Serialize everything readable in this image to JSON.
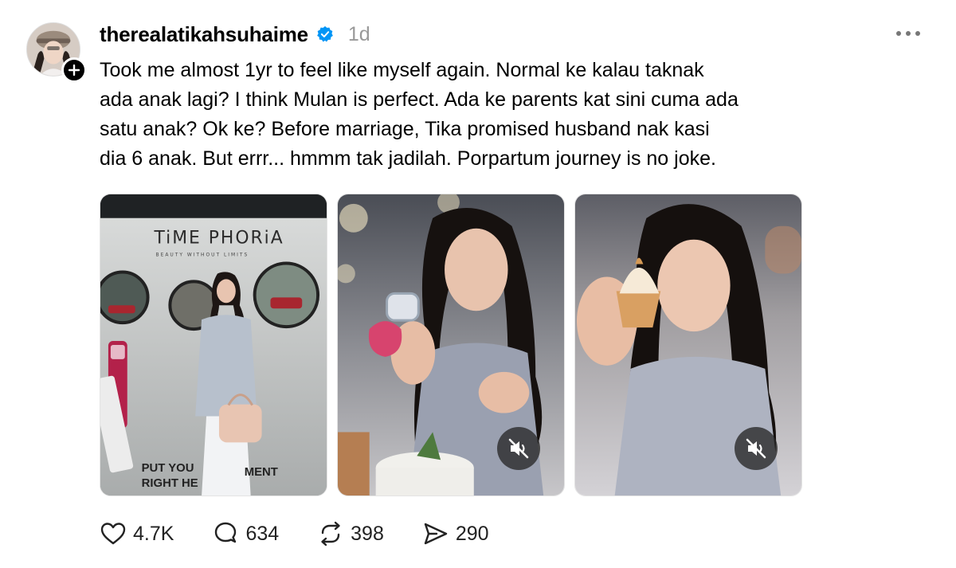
{
  "post": {
    "username": "therealatikahsuhaime",
    "verified": true,
    "timestamp": "1d",
    "caption_lines": [
      "Took me almost 1yr to feel like myself again. Normal ke kalau taknak",
      "ada anak lagi? I think Mulan is perfect. Ada ke parents kat sini cuma ada",
      "satu anak? Ok ke? Before marriage, Tika promised husband nak kasi",
      "dia 6 anak. But errr... hmmm tak jadilah. Porpartum journey is no joke."
    ],
    "media": [
      {
        "type": "image",
        "sign_brand": "TiME PHORiA",
        "sign_tagline": "BEAUTY WITHOUT LIMITS",
        "sign_bottom_line1": "PUT YOU",
        "sign_bottom_line1b": "MENT",
        "sign_bottom_line2": "RIGHT HE"
      },
      {
        "type": "video",
        "muted": true,
        "mute_icon": "speaker-muted-icon"
      },
      {
        "type": "video",
        "muted": true,
        "mute_icon": "speaker-muted-icon"
      }
    ],
    "stats": {
      "likes": "4.7K",
      "comments": "634",
      "reposts": "398",
      "shares": "290"
    }
  },
  "colors": {
    "verified_blue": "#0095f6",
    "timestamp_gray": "#999999",
    "text": "#000000"
  }
}
